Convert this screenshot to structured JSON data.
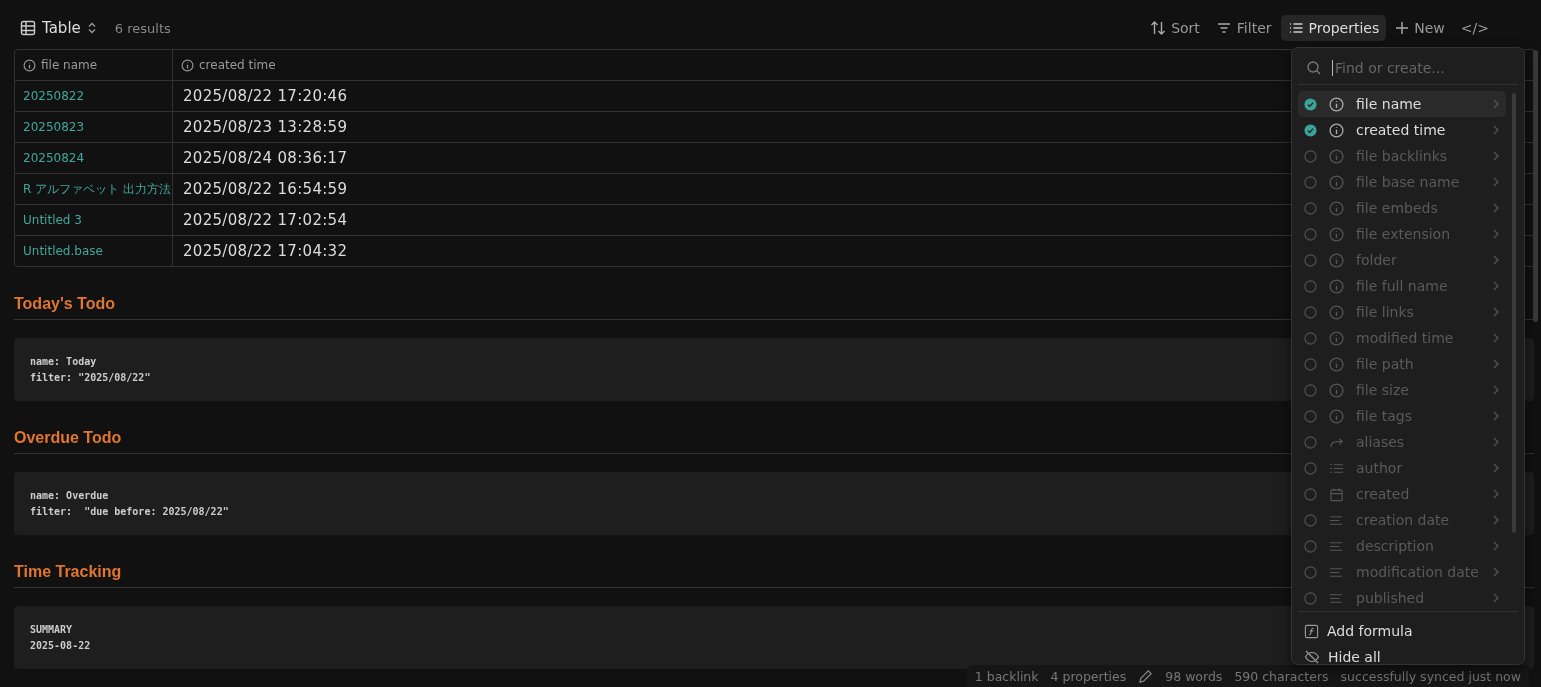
{
  "toolbar": {
    "view": "Table",
    "results": "6 results",
    "actions": [
      {
        "kind": "sort",
        "label": "Sort",
        "selected": false
      },
      {
        "kind": "filter",
        "label": "Filter",
        "selected": false
      },
      {
        "kind": "properties",
        "label": "Properties",
        "selected": true
      },
      {
        "kind": "new",
        "label": "New",
        "selected": false
      },
      {
        "kind": "code",
        "label": "</>",
        "selected": false
      }
    ]
  },
  "table": {
    "columns": [
      "file name",
      "created time"
    ],
    "rows": [
      {
        "file_name": "20250822",
        "created_time": "2025/08/22 17:20:46"
      },
      {
        "file_name": "20250823",
        "created_time": "2025/08/23 13:28:59"
      },
      {
        "file_name": "20250824",
        "created_time": "2025/08/24 08:36:17"
      },
      {
        "file_name": "R アルファベット 出力方法",
        "created_time": "2025/08/22 16:54:59"
      },
      {
        "file_name": "Untitled 3",
        "created_time": "2025/08/22 17:02:54"
      },
      {
        "file_name": "Untitled.base",
        "created_time": "2025/08/22 17:04:32"
      }
    ]
  },
  "sections": [
    {
      "heading": "Today's Todo",
      "code": [
        "name: Today",
        "filter: \"2025/08/22\""
      ]
    },
    {
      "heading": "Overdue Todo",
      "code": [
        "name: Overdue",
        "filter:  \"due before: 2025/08/22\""
      ]
    },
    {
      "heading": "Time Tracking",
      "code": [
        "SUMMARY",
        "2025-08-22"
      ]
    }
  ],
  "properties_menu": {
    "placeholder": "Find or create...",
    "items": [
      {
        "label": "file name",
        "kind": "info",
        "checked": true,
        "selected": true
      },
      {
        "label": "created time",
        "kind": "info",
        "checked": true,
        "selected": false
      },
      {
        "label": "file backlinks",
        "kind": "info",
        "checked": false,
        "selected": false
      },
      {
        "label": "file base name",
        "kind": "info",
        "checked": false,
        "selected": false
      },
      {
        "label": "file embeds",
        "kind": "info",
        "checked": false,
        "selected": false
      },
      {
        "label": "file extension",
        "kind": "info",
        "checked": false,
        "selected": false
      },
      {
        "label": "folder",
        "kind": "info",
        "checked": false,
        "selected": false
      },
      {
        "label": "file full name",
        "kind": "info",
        "checked": false,
        "selected": false
      },
      {
        "label": "file links",
        "kind": "info",
        "checked": false,
        "selected": false
      },
      {
        "label": "modified time",
        "kind": "info",
        "checked": false,
        "selected": false
      },
      {
        "label": "file path",
        "kind": "info",
        "checked": false,
        "selected": false
      },
      {
        "label": "file size",
        "kind": "info",
        "checked": false,
        "selected": false
      },
      {
        "label": "file tags",
        "kind": "info",
        "checked": false,
        "selected": false
      },
      {
        "label": "aliases",
        "kind": "alias",
        "checked": false,
        "selected": false
      },
      {
        "label": "author",
        "kind": "list",
        "checked": false,
        "selected": false
      },
      {
        "label": "created",
        "kind": "date",
        "checked": false,
        "selected": false
      },
      {
        "label": "creation date",
        "kind": "text",
        "checked": false,
        "selected": false
      },
      {
        "label": "description",
        "kind": "text",
        "checked": false,
        "selected": false
      },
      {
        "label": "modification date",
        "kind": "text",
        "checked": false,
        "selected": false
      },
      {
        "label": "published",
        "kind": "text",
        "checked": false,
        "selected": false
      }
    ],
    "footer": [
      {
        "kind": "formula",
        "label": "Add formula"
      },
      {
        "kind": "hide",
        "label": "Hide all"
      }
    ]
  },
  "status_bar": {
    "items": [
      "1 backlink",
      "4 properties"
    ],
    "counts": [
      "98 words",
      "590 characters"
    ],
    "sync": "successfully synced just now"
  }
}
